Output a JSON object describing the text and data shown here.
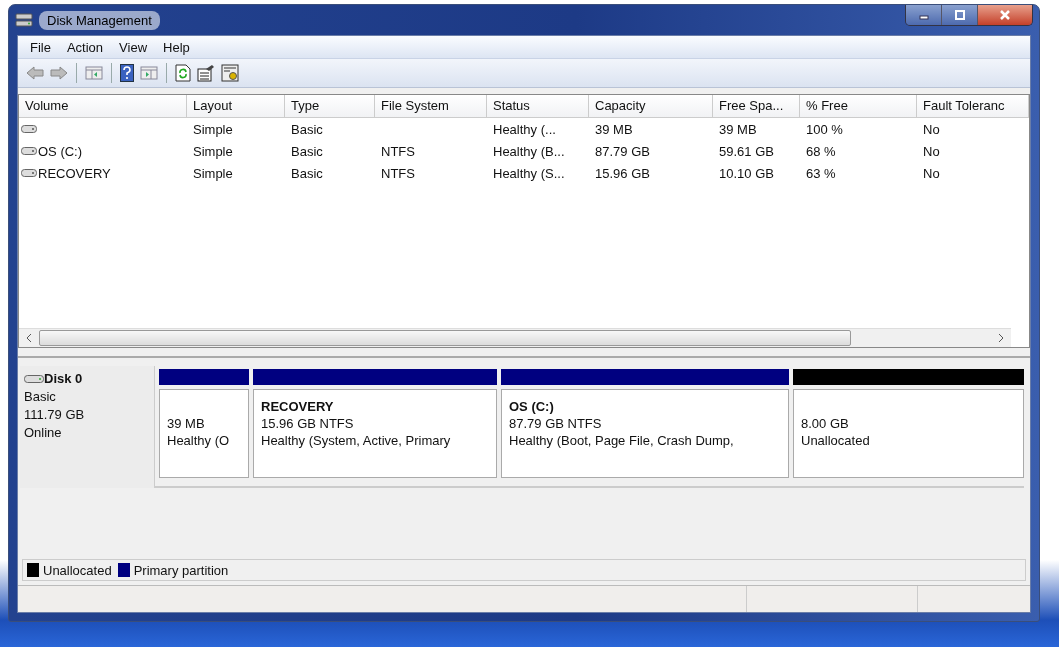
{
  "window": {
    "title": "Disk Management"
  },
  "menu": [
    "File",
    "Action",
    "View",
    "Help"
  ],
  "table": {
    "columns": [
      "Volume",
      "Layout",
      "Type",
      "File System",
      "Status",
      "Capacity",
      "Free Spa...",
      "% Free",
      "Fault Toleranc"
    ],
    "rows": [
      {
        "cells": [
          "",
          "Simple",
          "Basic",
          "",
          "Healthy (...",
          "39 MB",
          "39 MB",
          "100 %",
          "No"
        ]
      },
      {
        "cells": [
          "OS (C:)",
          "Simple",
          "Basic",
          "NTFS",
          "Healthy (B...",
          "87.79 GB",
          "59.61 GB",
          "68 %",
          "No"
        ]
      },
      {
        "cells": [
          "RECOVERY",
          "Simple",
          "Basic",
          "NTFS",
          "Healthy (S...",
          "15.96 GB",
          "10.10 GB",
          "63 %",
          "No"
        ]
      }
    ]
  },
  "disk": {
    "name": "Disk 0",
    "type": "Basic",
    "size": "111.79 GB",
    "state": "Online",
    "partitions": [
      {
        "color": "#000080",
        "size": "39 MB",
        "status": "Healthy (O"
      },
      {
        "color": "#000080",
        "title": "RECOVERY",
        "size": "15.96 GB NTFS",
        "status": "Healthy (System, Active, Primary"
      },
      {
        "color": "#000080",
        "title": "OS  (C:)",
        "size": "87.79 GB NTFS",
        "status": "Healthy (Boot, Page File, Crash Dump,"
      },
      {
        "color": "#000000",
        "size": "8.00 GB",
        "status": "Unallocated"
      }
    ]
  },
  "legend": [
    {
      "color": "#000000",
      "label": "Unallocated"
    },
    {
      "color": "#000080",
      "label": "Primary partition"
    }
  ]
}
